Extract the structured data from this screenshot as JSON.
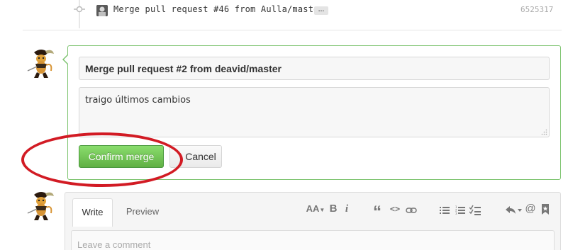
{
  "commit": {
    "message": "Merge pull request #46 from Aulla/master",
    "ellipsis": "…",
    "sha": "6525317"
  },
  "merge": {
    "title_value": "Merge pull request #2 from deavid/master",
    "description_value": "traigo últimos cambios",
    "confirm_label": "Confirm merge",
    "cancel_label": "Cancel",
    "accent_color": "#6cc644",
    "annotation_color": "#d21b24"
  },
  "comment": {
    "tabs": [
      {
        "label": "Write",
        "active": true
      },
      {
        "label": "Preview",
        "active": false
      }
    ],
    "toolbar": {
      "header": "AA",
      "bold": "B",
      "italic": "i",
      "quote": "“",
      "code": "<>",
      "link": "link-icon",
      "unordered_list": "list-icon",
      "ordered_list": "ordered-list-icon",
      "task_list": "task-list-icon",
      "reply": "reply-icon",
      "mention": "@",
      "bookmark": "bookmark-icon"
    },
    "placeholder": "Leave a comment"
  }
}
